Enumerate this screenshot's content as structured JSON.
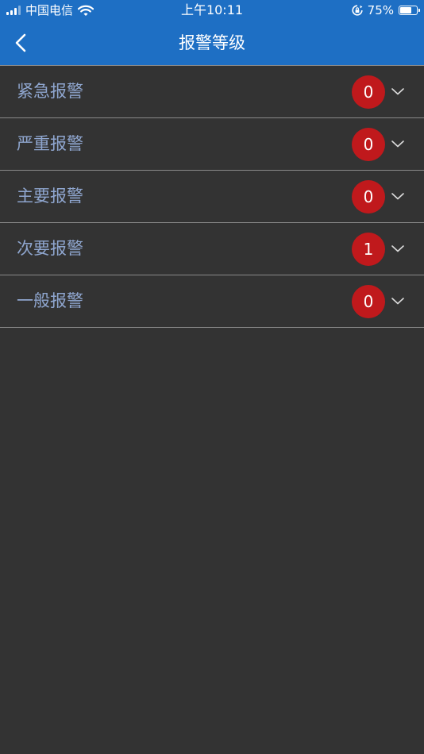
{
  "status_bar": {
    "carrier": "中国电信",
    "time": "上午10:11",
    "battery_percent": "75%",
    "battery_level": 0.75,
    "icons": [
      "signal-icon",
      "wifi-icon",
      "orientation-lock-icon",
      "battery-icon"
    ]
  },
  "nav": {
    "title": "报警等级",
    "back_icon": "chevron-left-icon",
    "background_color": "#1e6fc4"
  },
  "alarm_levels": [
    {
      "label": "紧急报警",
      "count": "0"
    },
    {
      "label": "严重报警",
      "count": "0"
    },
    {
      "label": "主要报警",
      "count": "0"
    },
    {
      "label": "次要报警",
      "count": "1"
    },
    {
      "label": "一般报警",
      "count": "0"
    }
  ],
  "colors": {
    "background": "#333333",
    "label_text": "#8fa6cf",
    "badge": "#c0191c",
    "divider": "#8a8a8a"
  }
}
